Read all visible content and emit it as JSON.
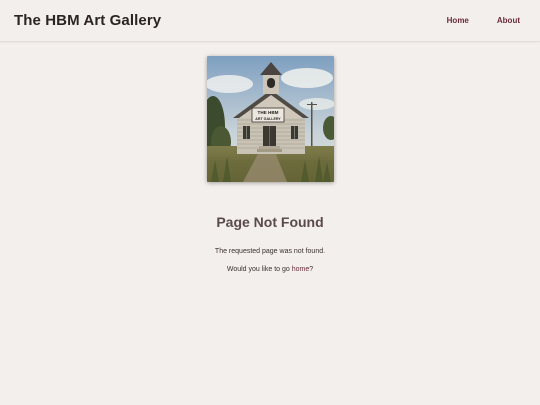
{
  "header": {
    "site_title": "The HBM Art Gallery",
    "nav": [
      {
        "label": "Home"
      },
      {
        "label": "About"
      }
    ]
  },
  "hero": {
    "sign_line1": "THE HBM",
    "sign_line2": "ART GALLERY"
  },
  "content": {
    "heading": "Page Not Found",
    "message": "The requested page was not found.",
    "prompt_before": "Would you like to go ",
    "prompt_link": "home",
    "prompt_after": "?"
  },
  "colors": {
    "background": "#f3efec",
    "accent": "#6a2a3a",
    "heading": "#5a4b4b"
  }
}
